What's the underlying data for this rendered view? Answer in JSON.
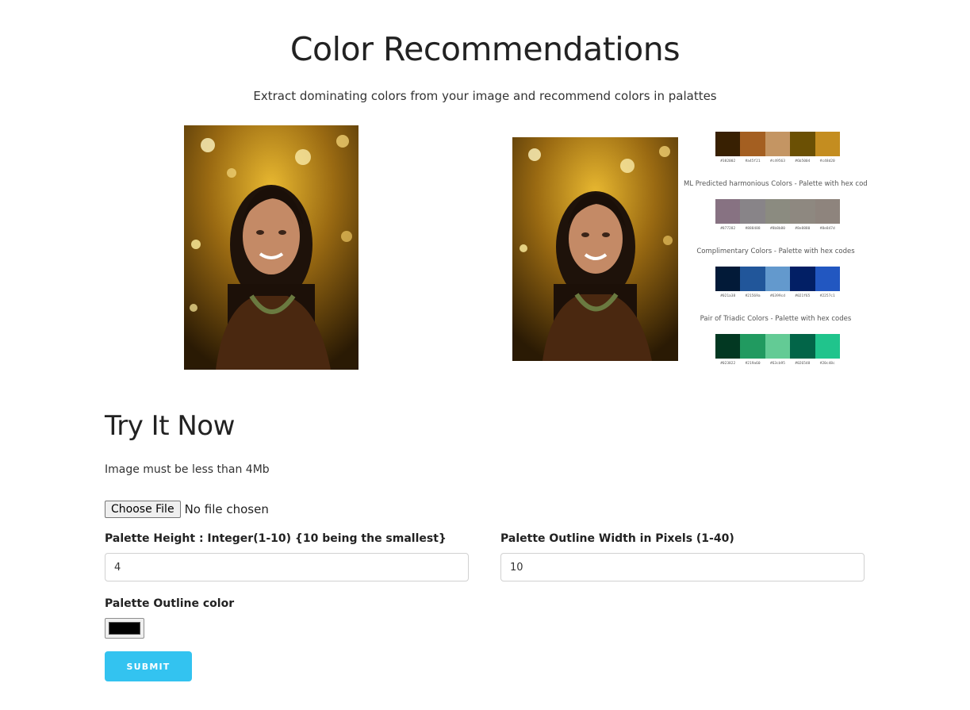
{
  "header": {
    "title": "Color Recommendations",
    "subtitle": "Extract dominating colors from your image and recommend colors in palattes"
  },
  "palettes": [
    {
      "label": "",
      "colors": [
        "#382002",
        "#a45f21",
        "#c49563",
        "#6b5004",
        "#c48d20"
      ],
      "hex_labels": [
        "#382002",
        "#a45f21",
        "#c49563",
        "#6b5004",
        "#c48d20"
      ]
    },
    {
      "label": "ML Predicted harmonious Colors - Palette with hex codes",
      "colors": [
        "#877282",
        "#888488",
        "#8b8b80",
        "#8e8880",
        "#8e847d"
      ],
      "hex_labels": [
        "#877282",
        "#888488",
        "#8b8b80",
        "#8e8880",
        "#8e847d"
      ]
    },
    {
      "label": "Complimentary Colors - Palette with hex codes",
      "colors": [
        "#021a38",
        "#21569a",
        "#6399cd",
        "#021f65",
        "#2257c1"
      ],
      "hex_labels": [
        "#021a38",
        "#21569a",
        "#6399cd",
        "#021f65",
        "#2257c1"
      ]
    },
    {
      "label": "Pair of Triadic Colors - Palette with hex codes",
      "colors": [
        "#023822",
        "#219a60",
        "#63cb95",
        "#026548",
        "#20c48c"
      ],
      "hex_labels": [
        "#023822",
        "#219a60",
        "#63cb95",
        "#026548",
        "#20c48c"
      ]
    }
  ],
  "try_section": {
    "title": "Try It Now",
    "note": "Image must be less than 4Mb",
    "file_button": "Choose File",
    "file_status": "No file chosen",
    "height_label": "Palette Height : Integer(1-10) {10 being the smallest}",
    "height_value": "4",
    "width_label": "Palette Outline Width in Pixels (1-40)",
    "width_value": "10",
    "outline_label": "Palette Outline color",
    "outline_color": "#000000",
    "submit_label": "SUBMIT"
  },
  "colors": {
    "accent": "#33c3f0"
  }
}
